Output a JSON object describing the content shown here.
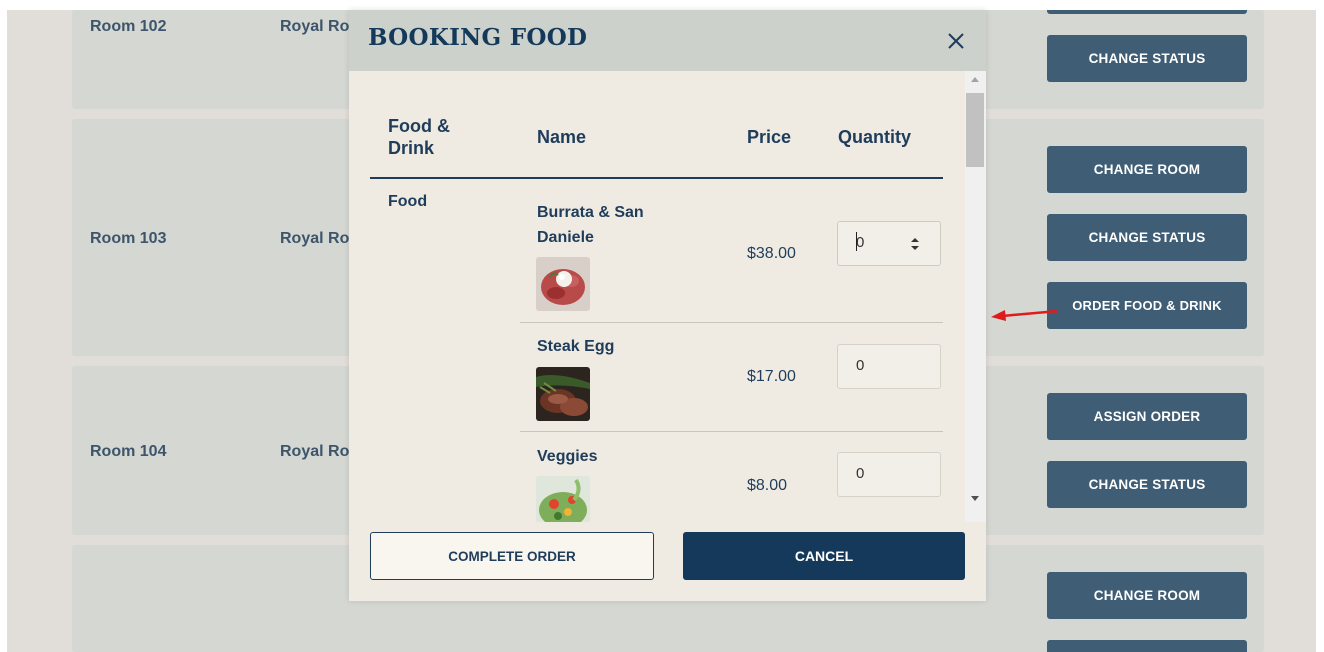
{
  "background": {
    "rooms": [
      {
        "name": "Room 102",
        "type": "Royal Ro",
        "actions": [
          "CHANGE STATUS"
        ]
      },
      {
        "name": "Room 103",
        "type": "Royal Ro",
        "actions": [
          "CHANGE ROOM",
          "CHANGE STATUS",
          "ORDER FOOD & DRINK"
        ]
      },
      {
        "name": "Room 104",
        "type": "Royal Ro",
        "actions": [
          "ASSIGN ORDER",
          "CHANGE STATUS"
        ]
      },
      {
        "name": "",
        "type": "",
        "actions": [
          "CHANGE ROOM"
        ]
      }
    ]
  },
  "modal": {
    "title": "BOOKING FOOD",
    "close_icon": "close-icon",
    "columns": {
      "category": "Food & Drink",
      "name": "Name",
      "price": "Price",
      "quantity": "Quantity"
    },
    "category": "Food",
    "items": [
      {
        "name": "Burrata & San Daniele",
        "price": "$38.00",
        "quantity": "0",
        "image": "burrata-thumbnail"
      },
      {
        "name": "Steak Egg",
        "price": "$17.00",
        "quantity": "0",
        "image": "steak-thumbnail"
      },
      {
        "name": "Veggies",
        "price": "$8.00",
        "quantity": "0",
        "image": "veggies-thumbnail"
      }
    ],
    "complete_label": "COMPLETE ORDER",
    "cancel_label": "CANCEL"
  },
  "colors": {
    "primary": "#14395a",
    "action_button": "#3f5d74",
    "annotation_arrow": "#e01b1b"
  }
}
